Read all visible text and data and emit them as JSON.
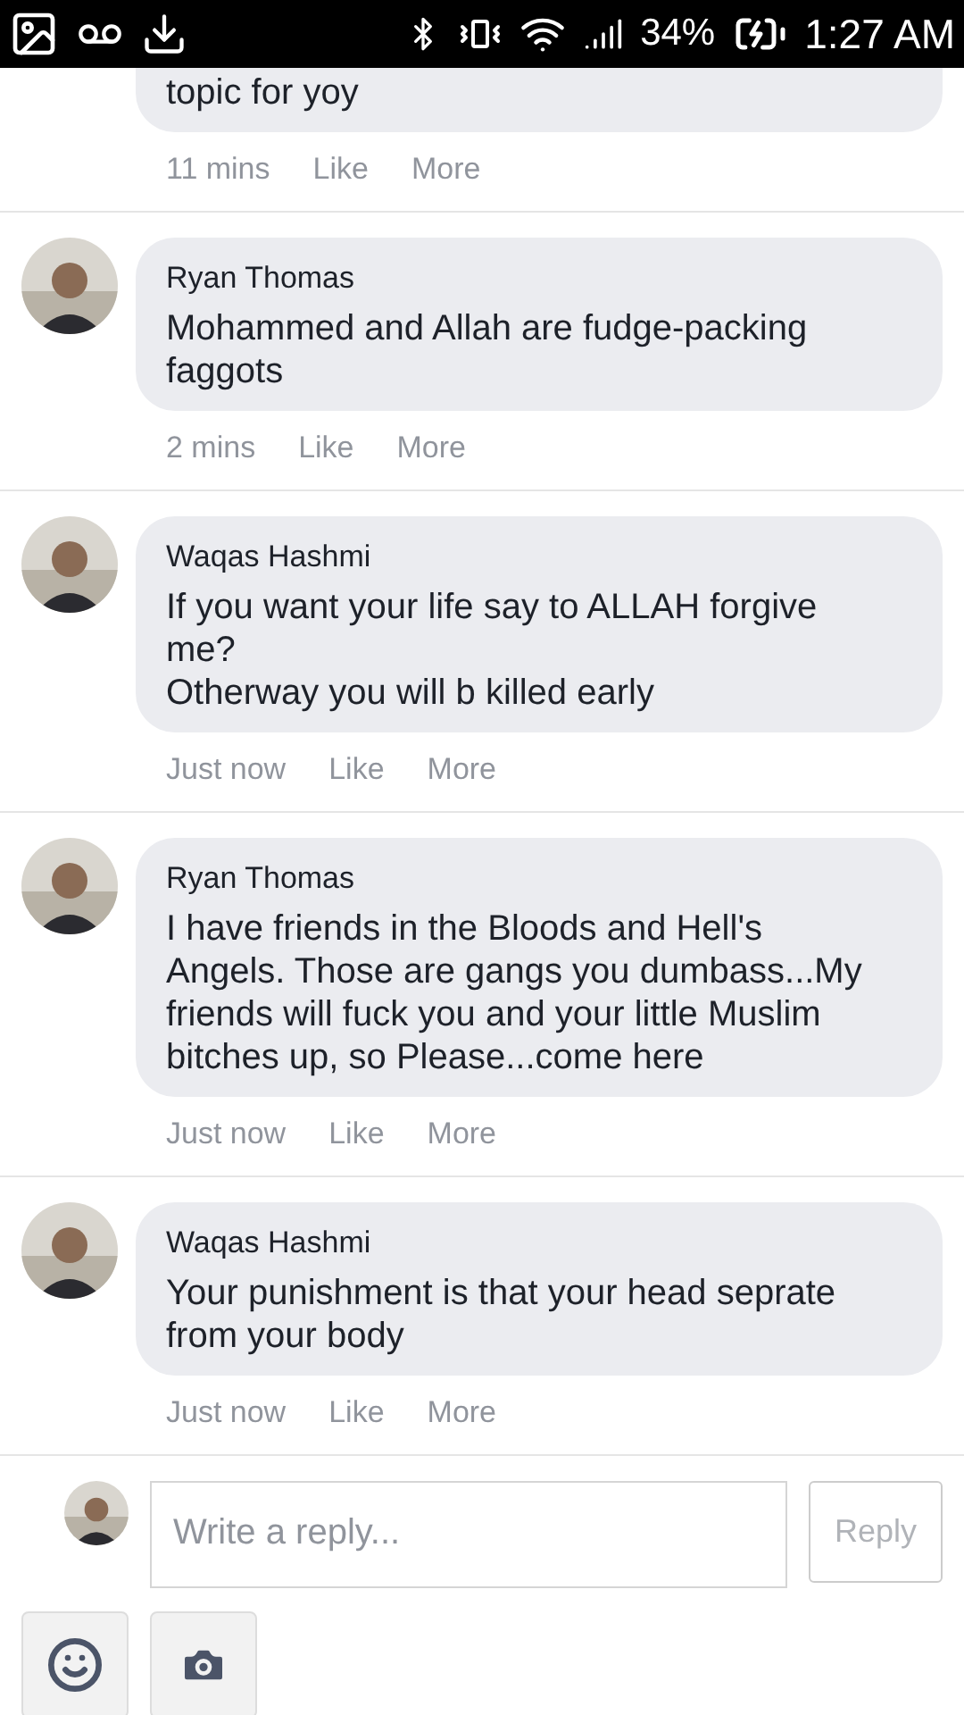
{
  "status_bar": {
    "battery": "34%",
    "time": "1:27 AM"
  },
  "comments": [
    {
      "text": "topic for yoy",
      "time": "11 mins",
      "actions": [
        "Like",
        "More"
      ]
    },
    {
      "author": "Ryan Thomas",
      "text": "Mohammed and Allah are fudge-packing faggots",
      "time": "2 mins",
      "actions": [
        "Like",
        "More"
      ]
    },
    {
      "author": "Waqas Hashmi",
      "text": "If you want your life say to ALLAH forgive me?\nOtherway you will b killed early",
      "time": "Just now",
      "actions": [
        "Like",
        "More"
      ]
    },
    {
      "author": "Ryan Thomas",
      "text": "I have friends in the Bloods and Hell's Angels. Those are gangs you dumbass...My friends will fuck you and your little Muslim bitches up, so Please...come here",
      "time": "Just now",
      "actions": [
        "Like",
        "More"
      ]
    },
    {
      "author": "Waqas Hashmi",
      "text": "Your punishment is that your head seprate from your body",
      "time": "Just now",
      "actions": [
        "Like",
        "More"
      ]
    }
  ],
  "composer": {
    "placeholder": "Write a reply...",
    "button": "Reply"
  }
}
